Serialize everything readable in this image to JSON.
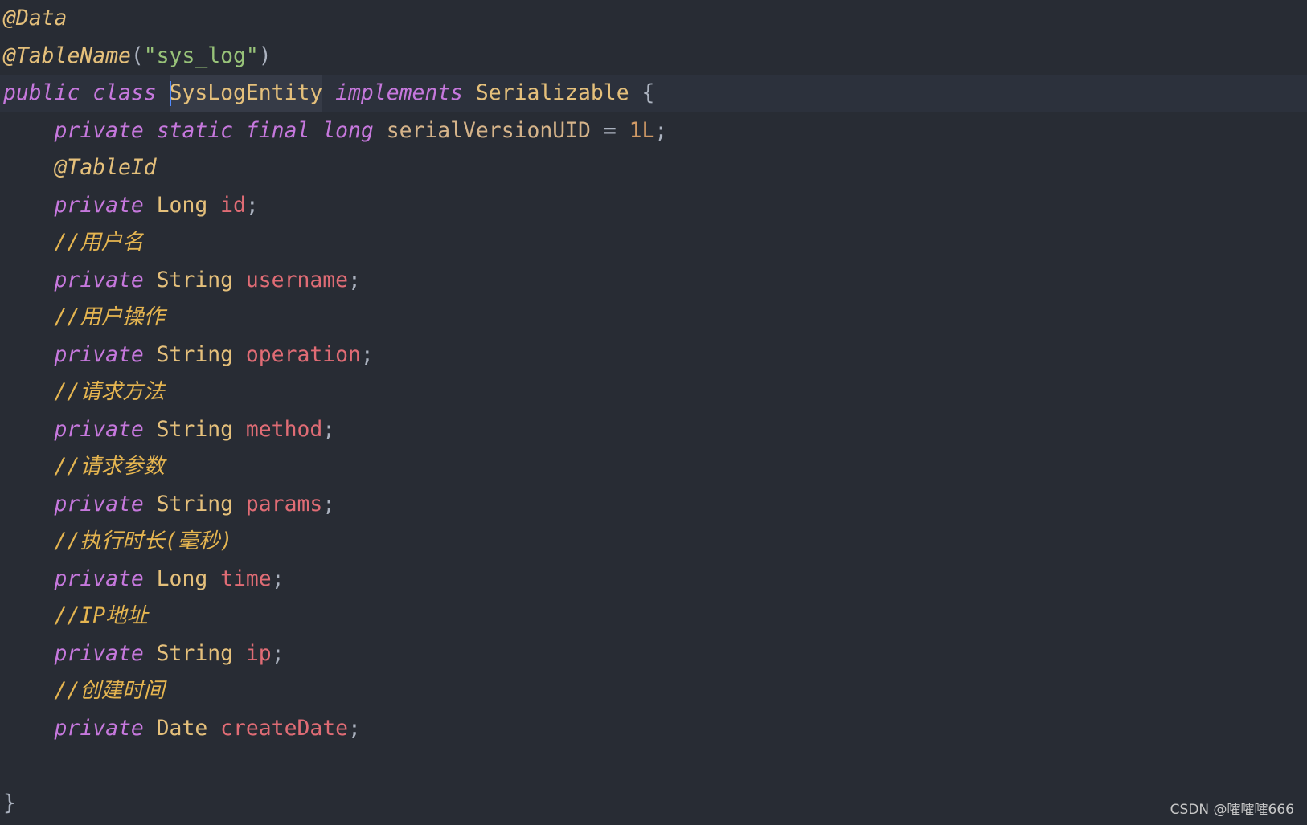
{
  "code": {
    "lines": [
      [
        "@Data"
      ],
      [
        "@TableName",
        "(",
        "\"sys_log\"",
        ")"
      ],
      [
        "public",
        "class",
        "SysLogEntity",
        "implements",
        "Serializable",
        "{"
      ],
      [
        "private",
        "static",
        "final",
        "long",
        "serialVersionUID",
        "=",
        "1L",
        ";"
      ],
      [
        "@TableId"
      ],
      [
        "private",
        "Long",
        "id",
        ";"
      ],
      [
        "//用户名"
      ],
      [
        "private",
        "String",
        "username",
        ";"
      ],
      [
        "//用户操作"
      ],
      [
        "private",
        "String",
        "operation",
        ";"
      ],
      [
        "//请求方法"
      ],
      [
        "private",
        "String",
        "method",
        ";"
      ],
      [
        "//请求参数"
      ],
      [
        "private",
        "String",
        "params",
        ";"
      ],
      [
        "//执行时长(毫秒)"
      ],
      [
        "private",
        "Long",
        "time",
        ";"
      ],
      [
        "//IP地址"
      ],
      [
        "private",
        "String",
        "ip",
        ";"
      ],
      [
        "//创建时间"
      ],
      [
        "private",
        "Date",
        "createDate",
        ";"
      ],
      [],
      [
        "}"
      ]
    ]
  },
  "watermark": "CSDN @嚯嚯嚯666",
  "theme": {
    "background": "#282c34",
    "current_line": "#2c313c",
    "word_highlight": "#363b47",
    "caret": "#528bff",
    "annotation": "#e5c07b",
    "keyword": "#c678dd",
    "type": "#e5c07b",
    "field": "#e06c75",
    "constant": "#d6b48a",
    "number": "#d19a66",
    "string": "#98c379",
    "comment": "#e5b550",
    "punctuation": "#abb2bf",
    "watermark": "#c8c8c8"
  }
}
